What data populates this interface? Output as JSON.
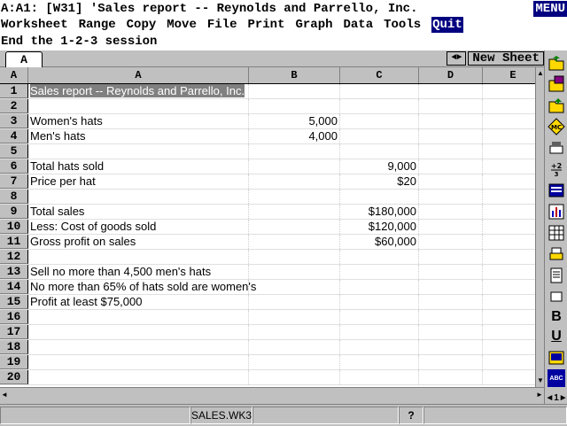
{
  "control_panel": {
    "line1": "A:A1: [W31] 'Sales report -- Reynolds and Parrello, Inc.",
    "menu_indicator": "MENU",
    "menu": [
      "Worksheet",
      "Range",
      "Copy",
      "Move",
      "File",
      "Print",
      "Graph",
      "Data",
      "Tools",
      "Quit"
    ],
    "selected_menu": "Quit",
    "description": "End the 1-2-3 session"
  },
  "tabs": {
    "active": "A",
    "new_sheet_label": "New Sheet"
  },
  "columns": [
    "A",
    "B",
    "C",
    "D",
    "E"
  ],
  "corner_label": "A",
  "rows": [
    {
      "n": "1",
      "a": "Sales report -- Reynolds and Parrello, Inc.",
      "b": "",
      "c": ""
    },
    {
      "n": "2",
      "a": "",
      "b": "",
      "c": ""
    },
    {
      "n": "3",
      "a": "Women's hats",
      "b": "5,000",
      "c": ""
    },
    {
      "n": "4",
      "a": "Men's hats",
      "b": "4,000",
      "c": ""
    },
    {
      "n": "5",
      "a": "",
      "b": "",
      "c": ""
    },
    {
      "n": "6",
      "a": "Total hats sold",
      "b": "",
      "c": "9,000"
    },
    {
      "n": "7",
      "a": "Price per hat",
      "b": "",
      "c": "$20"
    },
    {
      "n": "8",
      "a": "",
      "b": "",
      "c": ""
    },
    {
      "n": "9",
      "a": "Total sales",
      "b": "",
      "c": "$180,000"
    },
    {
      "n": "10",
      "a": "Less: Cost of goods sold",
      "b": "",
      "c": "$120,000"
    },
    {
      "n": "11",
      "a": "Gross profit on sales",
      "b": "",
      "c": "$60,000"
    },
    {
      "n": "12",
      "a": "",
      "b": "",
      "c": ""
    },
    {
      "n": "13",
      "a": "Sell no more than 4,500 men's hats",
      "b": "",
      "c": ""
    },
    {
      "n": "14",
      "a": "No more than 65% of hats sold are women's",
      "b": "",
      "c": ""
    },
    {
      "n": "15",
      "a": "Profit at least $75,000",
      "b": "",
      "c": ""
    },
    {
      "n": "16",
      "a": "",
      "b": "",
      "c": ""
    },
    {
      "n": "17",
      "a": "",
      "b": "",
      "c": ""
    },
    {
      "n": "18",
      "a": "",
      "b": "",
      "c": ""
    },
    {
      "n": "19",
      "a": "",
      "b": "",
      "c": ""
    },
    {
      "n": "20",
      "a": "",
      "b": "",
      "c": ""
    }
  ],
  "status": {
    "filename": "SALES.WK3",
    "help": "?"
  },
  "smarticons": {
    "bold_label": "B",
    "underline_label": "U",
    "spell_label": "ABC"
  },
  "colors": {
    "selection": "#000080",
    "menu_bg": "#ffffff",
    "chrome": "#c0c0c0"
  }
}
